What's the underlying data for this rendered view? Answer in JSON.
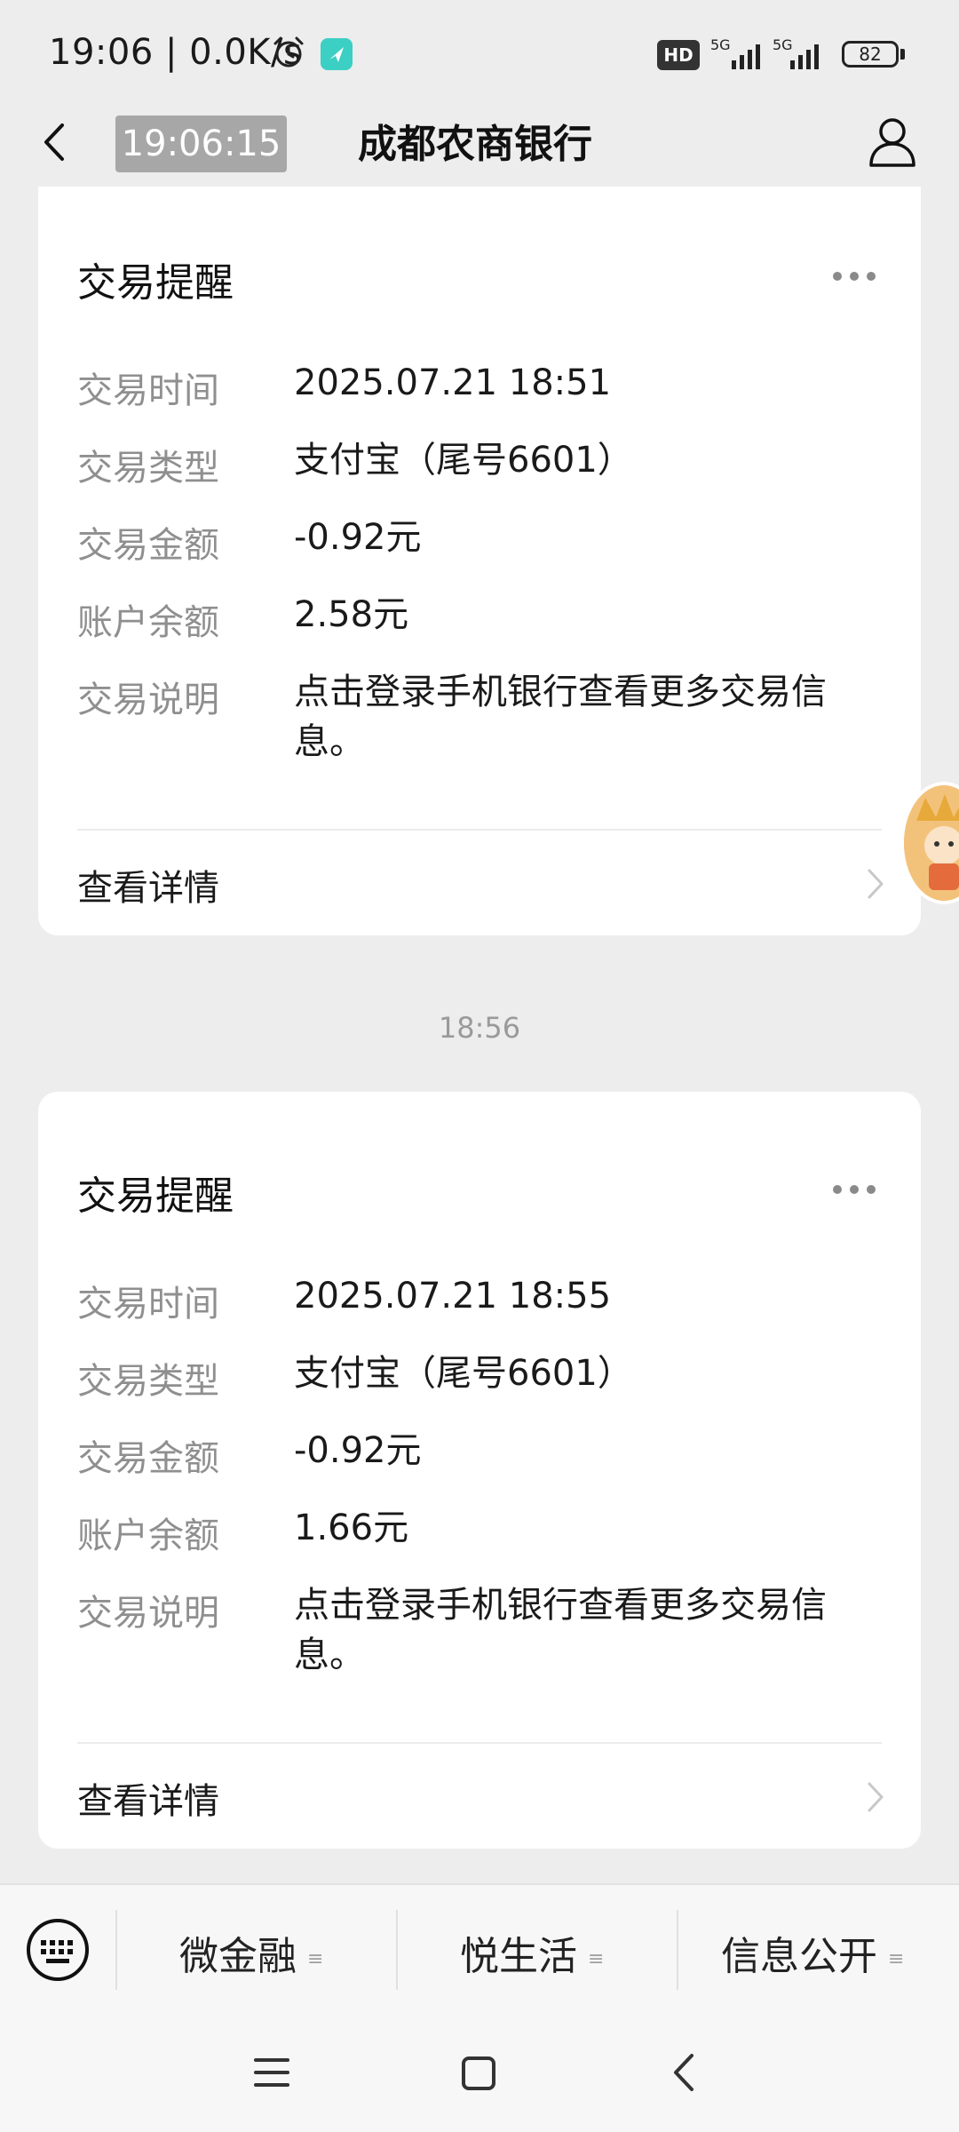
{
  "status_bar": {
    "time_speed": "19:06 | 0.0K/s",
    "hd_label": "HD",
    "network_1": "5G",
    "network_2": "5G",
    "battery": "82"
  },
  "header": {
    "timestamp_badge": "19:06:15",
    "title": "成都农商银行"
  },
  "cards": [
    {
      "title": "交易提醒",
      "rows": [
        {
          "label": "交易时间",
          "value": "2025.07.21 18:51"
        },
        {
          "label": "交易类型",
          "value": "支付宝（尾号6601）"
        },
        {
          "label": "交易金额",
          "value": "-0.92元"
        },
        {
          "label": "账户余额",
          "value": "2.58元"
        },
        {
          "label": "交易说明",
          "value": "点击登录手机银行查看更多交易信息。"
        }
      ],
      "detail_label": "查看详情"
    },
    {
      "title": "交易提醒",
      "rows": [
        {
          "label": "交易时间",
          "value": "2025.07.21 18:55"
        },
        {
          "label": "交易类型",
          "value": "支付宝（尾号6601）"
        },
        {
          "label": "交易金额",
          "value": "-0.92元"
        },
        {
          "label": "账户余额",
          "value": "1.66元"
        },
        {
          "label": "交易说明",
          "value": "点击登录手机银行查看更多交易信息。"
        }
      ],
      "detail_label": "查看详情"
    }
  ],
  "message_time": "18:56",
  "bottom_menu": [
    {
      "label": "微金融"
    },
    {
      "label": "悦生活"
    },
    {
      "label": "信息公开"
    }
  ],
  "icons": {
    "back": "back-arrow-icon",
    "user": "user-profile-icon",
    "more": "more-dots-icon",
    "chevron": "chevron-right-icon",
    "keyboard": "keyboard-icon",
    "nav_menu": "menu-icon",
    "nav_home": "home-icon",
    "nav_back": "back-icon"
  },
  "colors": {
    "background": "#ededed",
    "card": "#ffffff",
    "label_gray": "#8f8f8f",
    "badge_gray": "#a7a7a7"
  }
}
